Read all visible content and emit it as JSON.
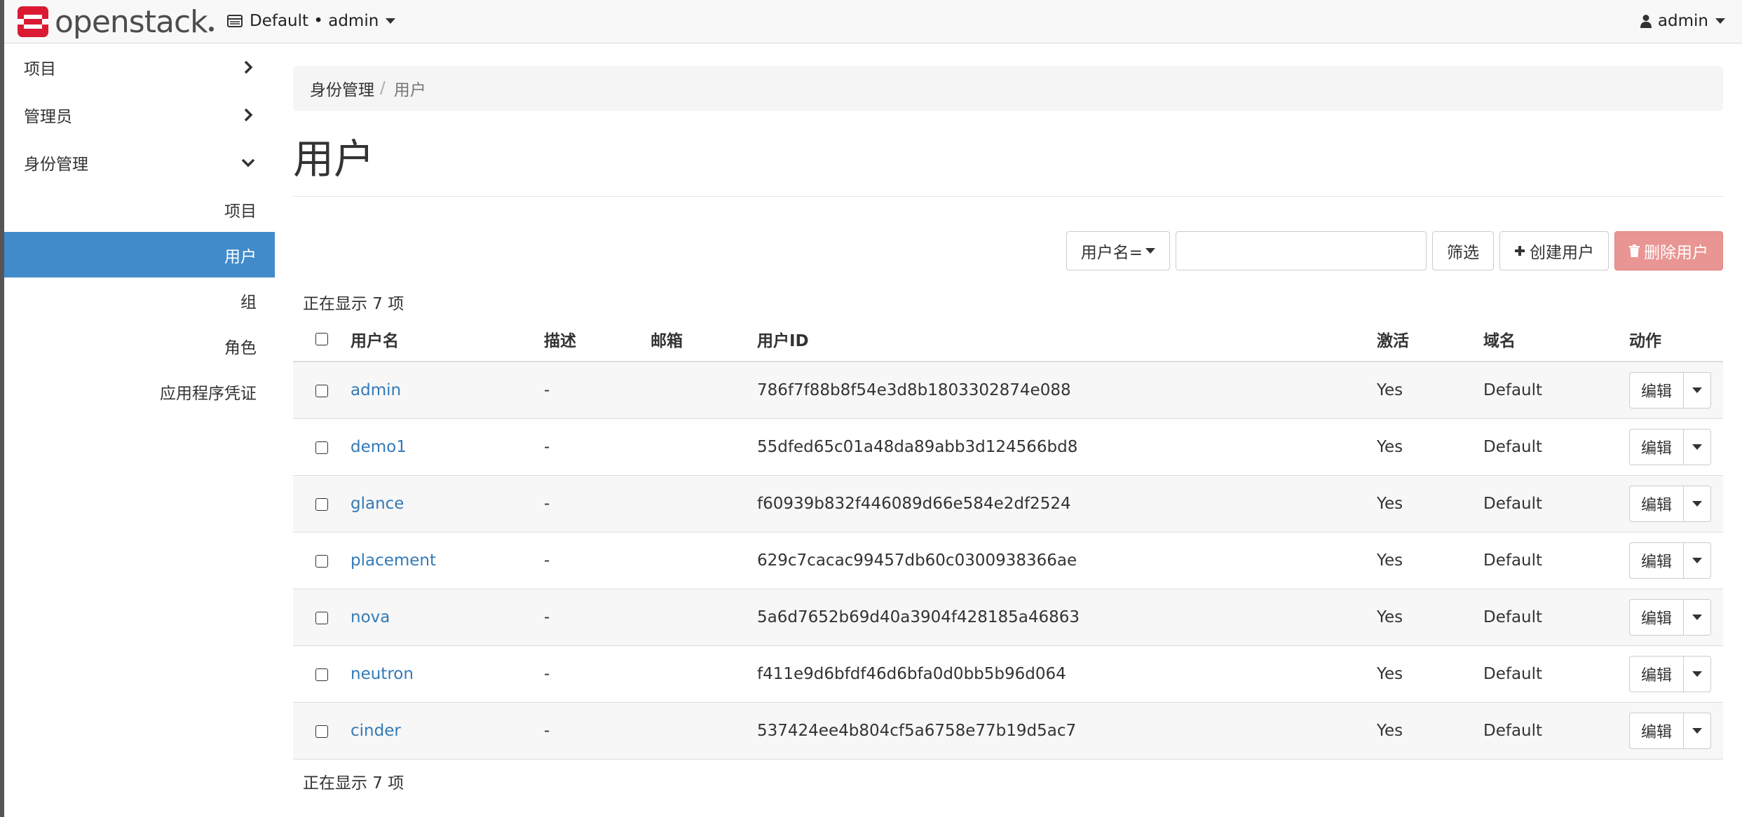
{
  "navbar": {
    "brand": "openstack",
    "domain_project": "Default • admin",
    "user": "admin"
  },
  "sidebar": {
    "sections": [
      {
        "label": "项目"
      },
      {
        "label": "管理员"
      },
      {
        "label": "身份管理"
      }
    ],
    "sub_items": [
      {
        "label": "项目"
      },
      {
        "label": "用户"
      },
      {
        "label": "组"
      },
      {
        "label": "角色"
      },
      {
        "label": "应用程序凭证"
      }
    ],
    "active": "用户"
  },
  "breadcrumb": {
    "parent": "身份管理",
    "separator": "/",
    "current": "用户"
  },
  "page_title": "用户",
  "filter": {
    "field_label": "用户名=",
    "input_value": "",
    "filter_button": "筛选",
    "create_button": "创建用户",
    "delete_button": "删除用户"
  },
  "count_text": "正在显示 7 项",
  "table": {
    "headers": {
      "name": "用户名",
      "description": "描述",
      "email": "邮箱",
      "id": "用户ID",
      "enabled": "激活",
      "domain": "域名",
      "actions": "动作"
    },
    "rows": [
      {
        "name": "admin",
        "description": "-",
        "email": "",
        "id": "786f7f88b8f54e3d8b1803302874e088",
        "enabled": "Yes",
        "domain": "Default",
        "action": "编辑"
      },
      {
        "name": "demo1",
        "description": "-",
        "email": "",
        "id": "55dfed65c01a48da89abb3d124566bd8",
        "enabled": "Yes",
        "domain": "Default",
        "action": "编辑"
      },
      {
        "name": "glance",
        "description": "-",
        "email": "",
        "id": "f60939b832f446089d66e584e2df2524",
        "enabled": "Yes",
        "domain": "Default",
        "action": "编辑"
      },
      {
        "name": "placement",
        "description": "-",
        "email": "",
        "id": "629c7cacac99457db60c0300938366ae",
        "enabled": "Yes",
        "domain": "Default",
        "action": "编辑"
      },
      {
        "name": "nova",
        "description": "-",
        "email": "",
        "id": "5a6d7652b69d40a3904f428185a46863",
        "enabled": "Yes",
        "domain": "Default",
        "action": "编辑"
      },
      {
        "name": "neutron",
        "description": "-",
        "email": "",
        "id": "f411e9d6bfdf46d6bfa0d0bb5b96d064",
        "enabled": "Yes",
        "domain": "Default",
        "action": "编辑"
      },
      {
        "name": "cinder",
        "description": "-",
        "email": "",
        "id": "537424ee4b804cf5a6758e77b19d5ac7",
        "enabled": "Yes",
        "domain": "Default",
        "action": "编辑"
      }
    ]
  },
  "colors": {
    "accent": "#428bca",
    "link": "#337ab7",
    "danger": "#e99593",
    "brand_red": "#da1a32"
  },
  "icons": [
    "openstack-logo-icon",
    "server-icon",
    "user-icon",
    "chevron-right-icon",
    "chevron-down-icon",
    "plus-icon",
    "trash-icon",
    "caret-down-icon",
    "checkbox-icon"
  ]
}
